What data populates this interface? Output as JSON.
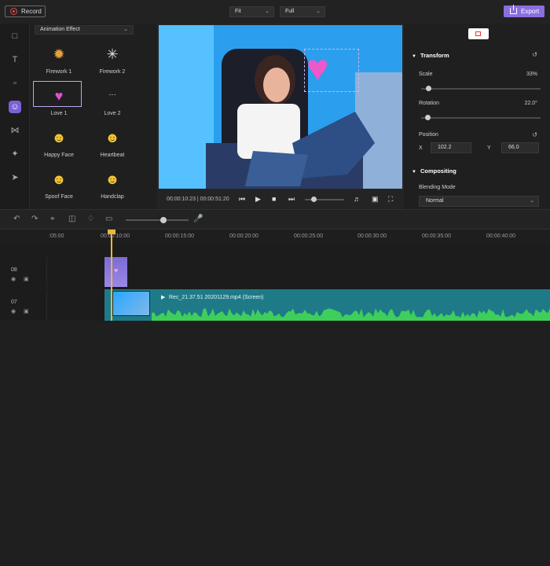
{
  "topbar": {
    "record_label": "Record",
    "fit_value": "Fit",
    "quality_value": "Full",
    "export_label": "Export"
  },
  "sidebar": {
    "icons": [
      "folder-icon",
      "text-icon",
      "annotation-icon",
      "effects-icon",
      "transition-icon",
      "magic-icon",
      "pin-icon"
    ]
  },
  "effects": {
    "category": "Animation Effect",
    "items": [
      {
        "label": "Firework 1"
      },
      {
        "label": "Firework 2"
      },
      {
        "label": "Love 1"
      },
      {
        "label": "Love 2"
      },
      {
        "label": "Happy Face"
      },
      {
        "label": "Heartbeat"
      },
      {
        "label": "Spoof Face"
      },
      {
        "label": "Handclap"
      }
    ]
  },
  "player": {
    "time": "00:00:10:23 | 00:00:51:20"
  },
  "properties": {
    "transform_label": "Transform",
    "scale_label": "Scale",
    "scale_value": "33%",
    "rotation_label": "Rotation",
    "rotation_value": "22.0°",
    "position_label": "Position",
    "x_label": "X",
    "x_value": "102.2",
    "y_label": "Y",
    "y_value": "66.0",
    "compositing_label": "Compositing",
    "blending_label": "Blending Mode",
    "blending_value": "Normal"
  },
  "timeline": {
    "ticks": [
      ":05:00",
      "00:00:10:00",
      "00:00:15:00",
      "00:00:20:00",
      "00:00:25:00",
      "00:00:30:00",
      "00:00:35:00",
      "00:00:40:00"
    ],
    "tracks": [
      {
        "num": "08"
      },
      {
        "num": "07"
      }
    ],
    "clip_name": "Rec_21.37.51 20201129.mp4 (Screen)"
  },
  "colors": {
    "accent": "#8a6ee0",
    "clip": "#1f7a88",
    "wave": "#3ecf5a",
    "playhead": "#e7b83a"
  }
}
